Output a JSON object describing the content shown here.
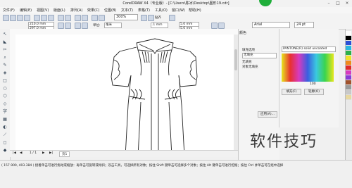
{
  "window": {
    "title": "CorelDRAW X4（专业版）- [C:\\Users\\陈冰\\Desktop\\图形19.cdr]"
  },
  "menu": {
    "items": [
      "文件(F)",
      "编辑(E)",
      "视图(V)",
      "版面(L)",
      "排列(A)",
      "效果(C)",
      "位图(B)",
      "文本(T)",
      "表格(T)",
      "工具(O)",
      "窗口(W)",
      "帮助(H)"
    ]
  },
  "toolbar": {
    "zoom": "300%",
    "snap_label": "贴齐",
    "snap_icon": "magnet-icon"
  },
  "propbar": {
    "width": "210.0 mm",
    "height": "297.0 mm",
    "units_label": "单位:",
    "units": "毫米",
    "nudge": ".1 mm",
    "dup_x": "5.0 mm",
    "dup_y": "5.0 mm",
    "font": "Arial",
    "font_size": "24 pt"
  },
  "docker": {
    "tab": "颜色",
    "section_label": "填充选项",
    "fill_value": "无填充",
    "fill_label": "无填充",
    "object_fill_label": "对象无填充",
    "apply_button": "应用(A)..."
  },
  "colorpanel": {
    "model": "PANTONE(R) solid uncoated",
    "fill_button": "填充(F)",
    "outline_button": "轮廓(O)",
    "value": "100"
  },
  "pagebar": {
    "page_info": "1 / 1",
    "page_tab": "页1"
  },
  "status": {
    "text": "( 157.900, 403.384 )  接着单击可进行拖动或缩放：再单击可旋转或倾斜；双击工具，可选择所有对象；按住 Shift 键单击可选择多个对象；按住 Alt 键单击可进行挖掘；按住 Ctrl 并单击可在组中选择"
  },
  "watermark": {
    "text": "软件技巧"
  },
  "colors": {
    "accent": "#1fae3a",
    "drawing": "#222222",
    "canvas": "#ffffff"
  }
}
